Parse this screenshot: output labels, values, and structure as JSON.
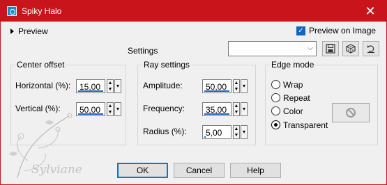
{
  "window": {
    "title": "Spiky Halo",
    "close_glyph": "✕"
  },
  "preview": {
    "toggle_label": "Preview",
    "preview_on_image_label": "Preview on Image",
    "preview_on_image_checked": true
  },
  "settings": {
    "label": "Settings",
    "preset_value": ""
  },
  "center_offset": {
    "title": "Center offset",
    "horizontal": {
      "label": "Horizontal (%):",
      "value": "15,00"
    },
    "vertical": {
      "label": "Vertical (%):",
      "value": "50,00"
    }
  },
  "ray_settings": {
    "title": "Ray settings",
    "amplitude": {
      "label": "Amplitude:",
      "value": "50,00"
    },
    "frequency": {
      "label": "Frequency:",
      "value": "35,00"
    },
    "radius": {
      "label": "Radius (%):",
      "value": "5,00"
    }
  },
  "edge_mode": {
    "title": "Edge mode",
    "options": [
      {
        "label": "Wrap",
        "selected": false
      },
      {
        "label": "Repeat",
        "selected": false
      },
      {
        "label": "Color",
        "selected": false
      },
      {
        "label": "Transparent",
        "selected": true
      }
    ]
  },
  "buttons": {
    "ok": "OK",
    "cancel": "Cancel",
    "help": "Help"
  },
  "watermark": {
    "text": "Sylviane"
  }
}
